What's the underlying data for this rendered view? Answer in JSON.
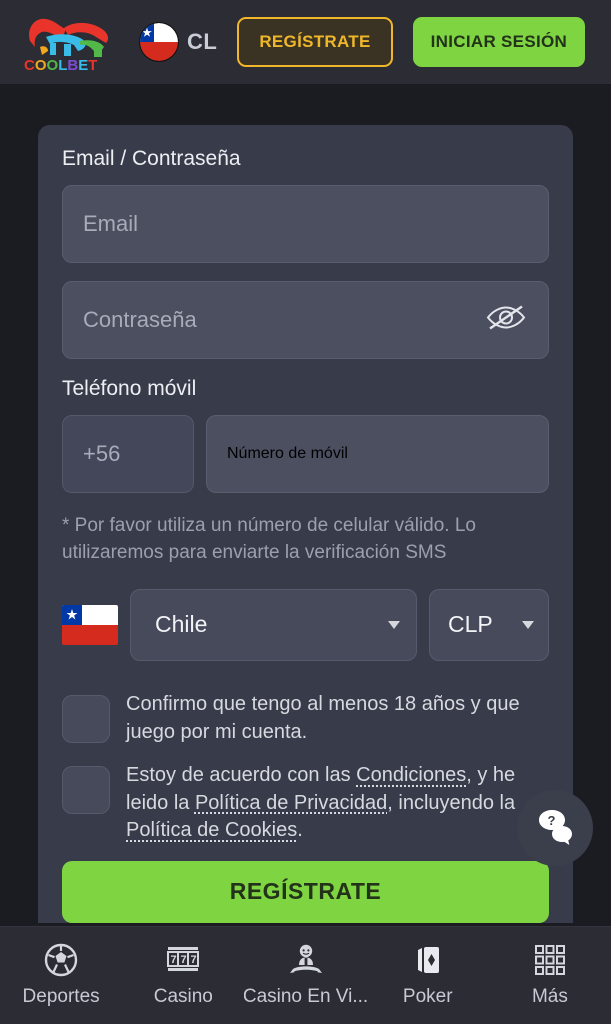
{
  "header": {
    "logo_name": "coolbet-logo",
    "logo_text": "COOLBET",
    "country_code": "CL",
    "country_flag": "chile-flag-icon",
    "register_label": "REGÍSTRATE",
    "login_label": "INICIAR SESIÓN"
  },
  "form": {
    "email_section_label": "Email / Contraseña",
    "email_placeholder": "Email",
    "password_placeholder": "Contraseña",
    "password_toggle_icon": "eye-off-icon",
    "phone_label": "Teléfono móvil",
    "phone_prefix": "+56",
    "phone_placeholder": "Número de móvil",
    "phone_hint": "* Por favor utiliza un número de celular válido. Lo utilizaremos para enviarte la verificación SMS",
    "country_flag": "chile-flag-icon",
    "country_value": "Chile",
    "currency_value": "CLP",
    "checkbox_age": "Confirmo que tengo al menos 18 años y que juego por mi cuenta.",
    "checkbox_terms_parts": {
      "p1": "Estoy de acuerdo con las ",
      "link1": "Condiciones",
      "p2": ", y he leido la ",
      "link2": "Política de Privacidad",
      "p3": ", incluyendo la ",
      "link3": "Política de Cookies",
      "p4": "."
    },
    "submit_label": "REGÍSTRATE"
  },
  "help": {
    "icon": "chat-question-icon"
  },
  "bottom_nav": {
    "items": [
      {
        "label": "Deportes",
        "icon": "soccer-ball-icon"
      },
      {
        "label": "Casino",
        "icon": "slot-machine-icon"
      },
      {
        "label": "Casino En Vi...",
        "icon": "live-dealer-icon"
      },
      {
        "label": "Poker",
        "icon": "playing-cards-icon"
      },
      {
        "label": "Más",
        "icon": "grid-menu-icon"
      }
    ]
  },
  "colors": {
    "page_bg": "#1b1b22",
    "header_bg": "#2b2c34",
    "card_bg": "#383b49",
    "input_bg": "#4c4f60",
    "accent_green": "#7ed441",
    "accent_gold": "#f0b72a"
  }
}
